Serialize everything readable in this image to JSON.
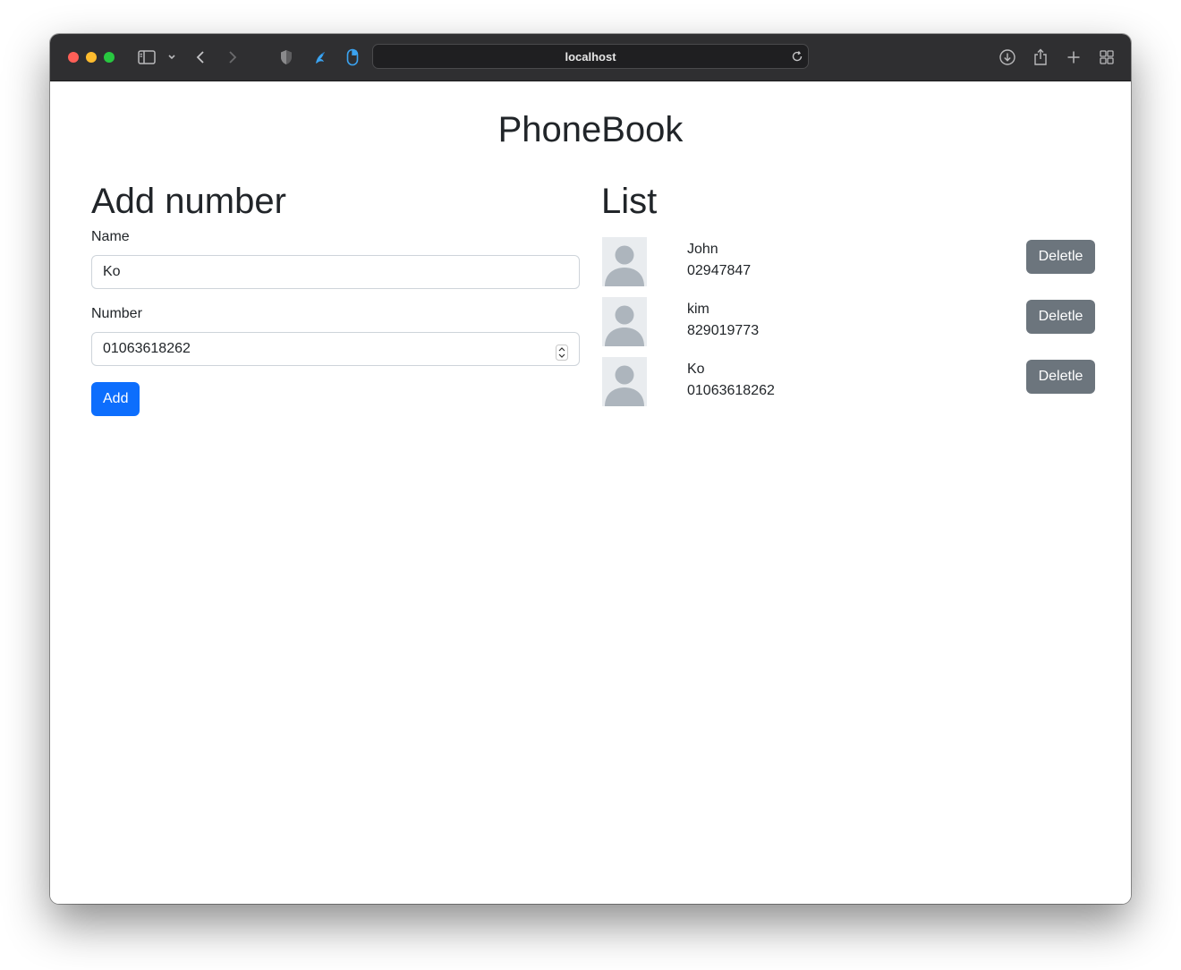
{
  "browser": {
    "url": "localhost",
    "icons": {
      "sidebar": "sidebar-icon",
      "chevron": "chevron-down-icon",
      "back": "back-icon",
      "forward": "forward-icon",
      "shield": "shield-icon",
      "extension1": "bird-extension-icon",
      "extension2": "mouse-extension-icon",
      "reload": "reload-icon",
      "download": "download-icon",
      "share": "share-icon",
      "newtab": "plus-icon",
      "tabs": "tab-overview-icon"
    }
  },
  "page": {
    "title": "PhoneBook"
  },
  "form": {
    "heading": "Add number",
    "name_label": "Name",
    "name_value": "Ko",
    "number_label": "Number",
    "number_value": "01063618262",
    "add_label": "Add"
  },
  "list": {
    "heading": "List",
    "delete_label": "Deletle",
    "entries": [
      {
        "name": "John",
        "number": "02947847"
      },
      {
        "name": "kim",
        "number": "829019773"
      },
      {
        "name": "Ko",
        "number": "01063618262"
      }
    ]
  },
  "colors": {
    "primary": "#0d6efd",
    "secondary": "#6c757d",
    "toolbar": "#2f2f31"
  }
}
